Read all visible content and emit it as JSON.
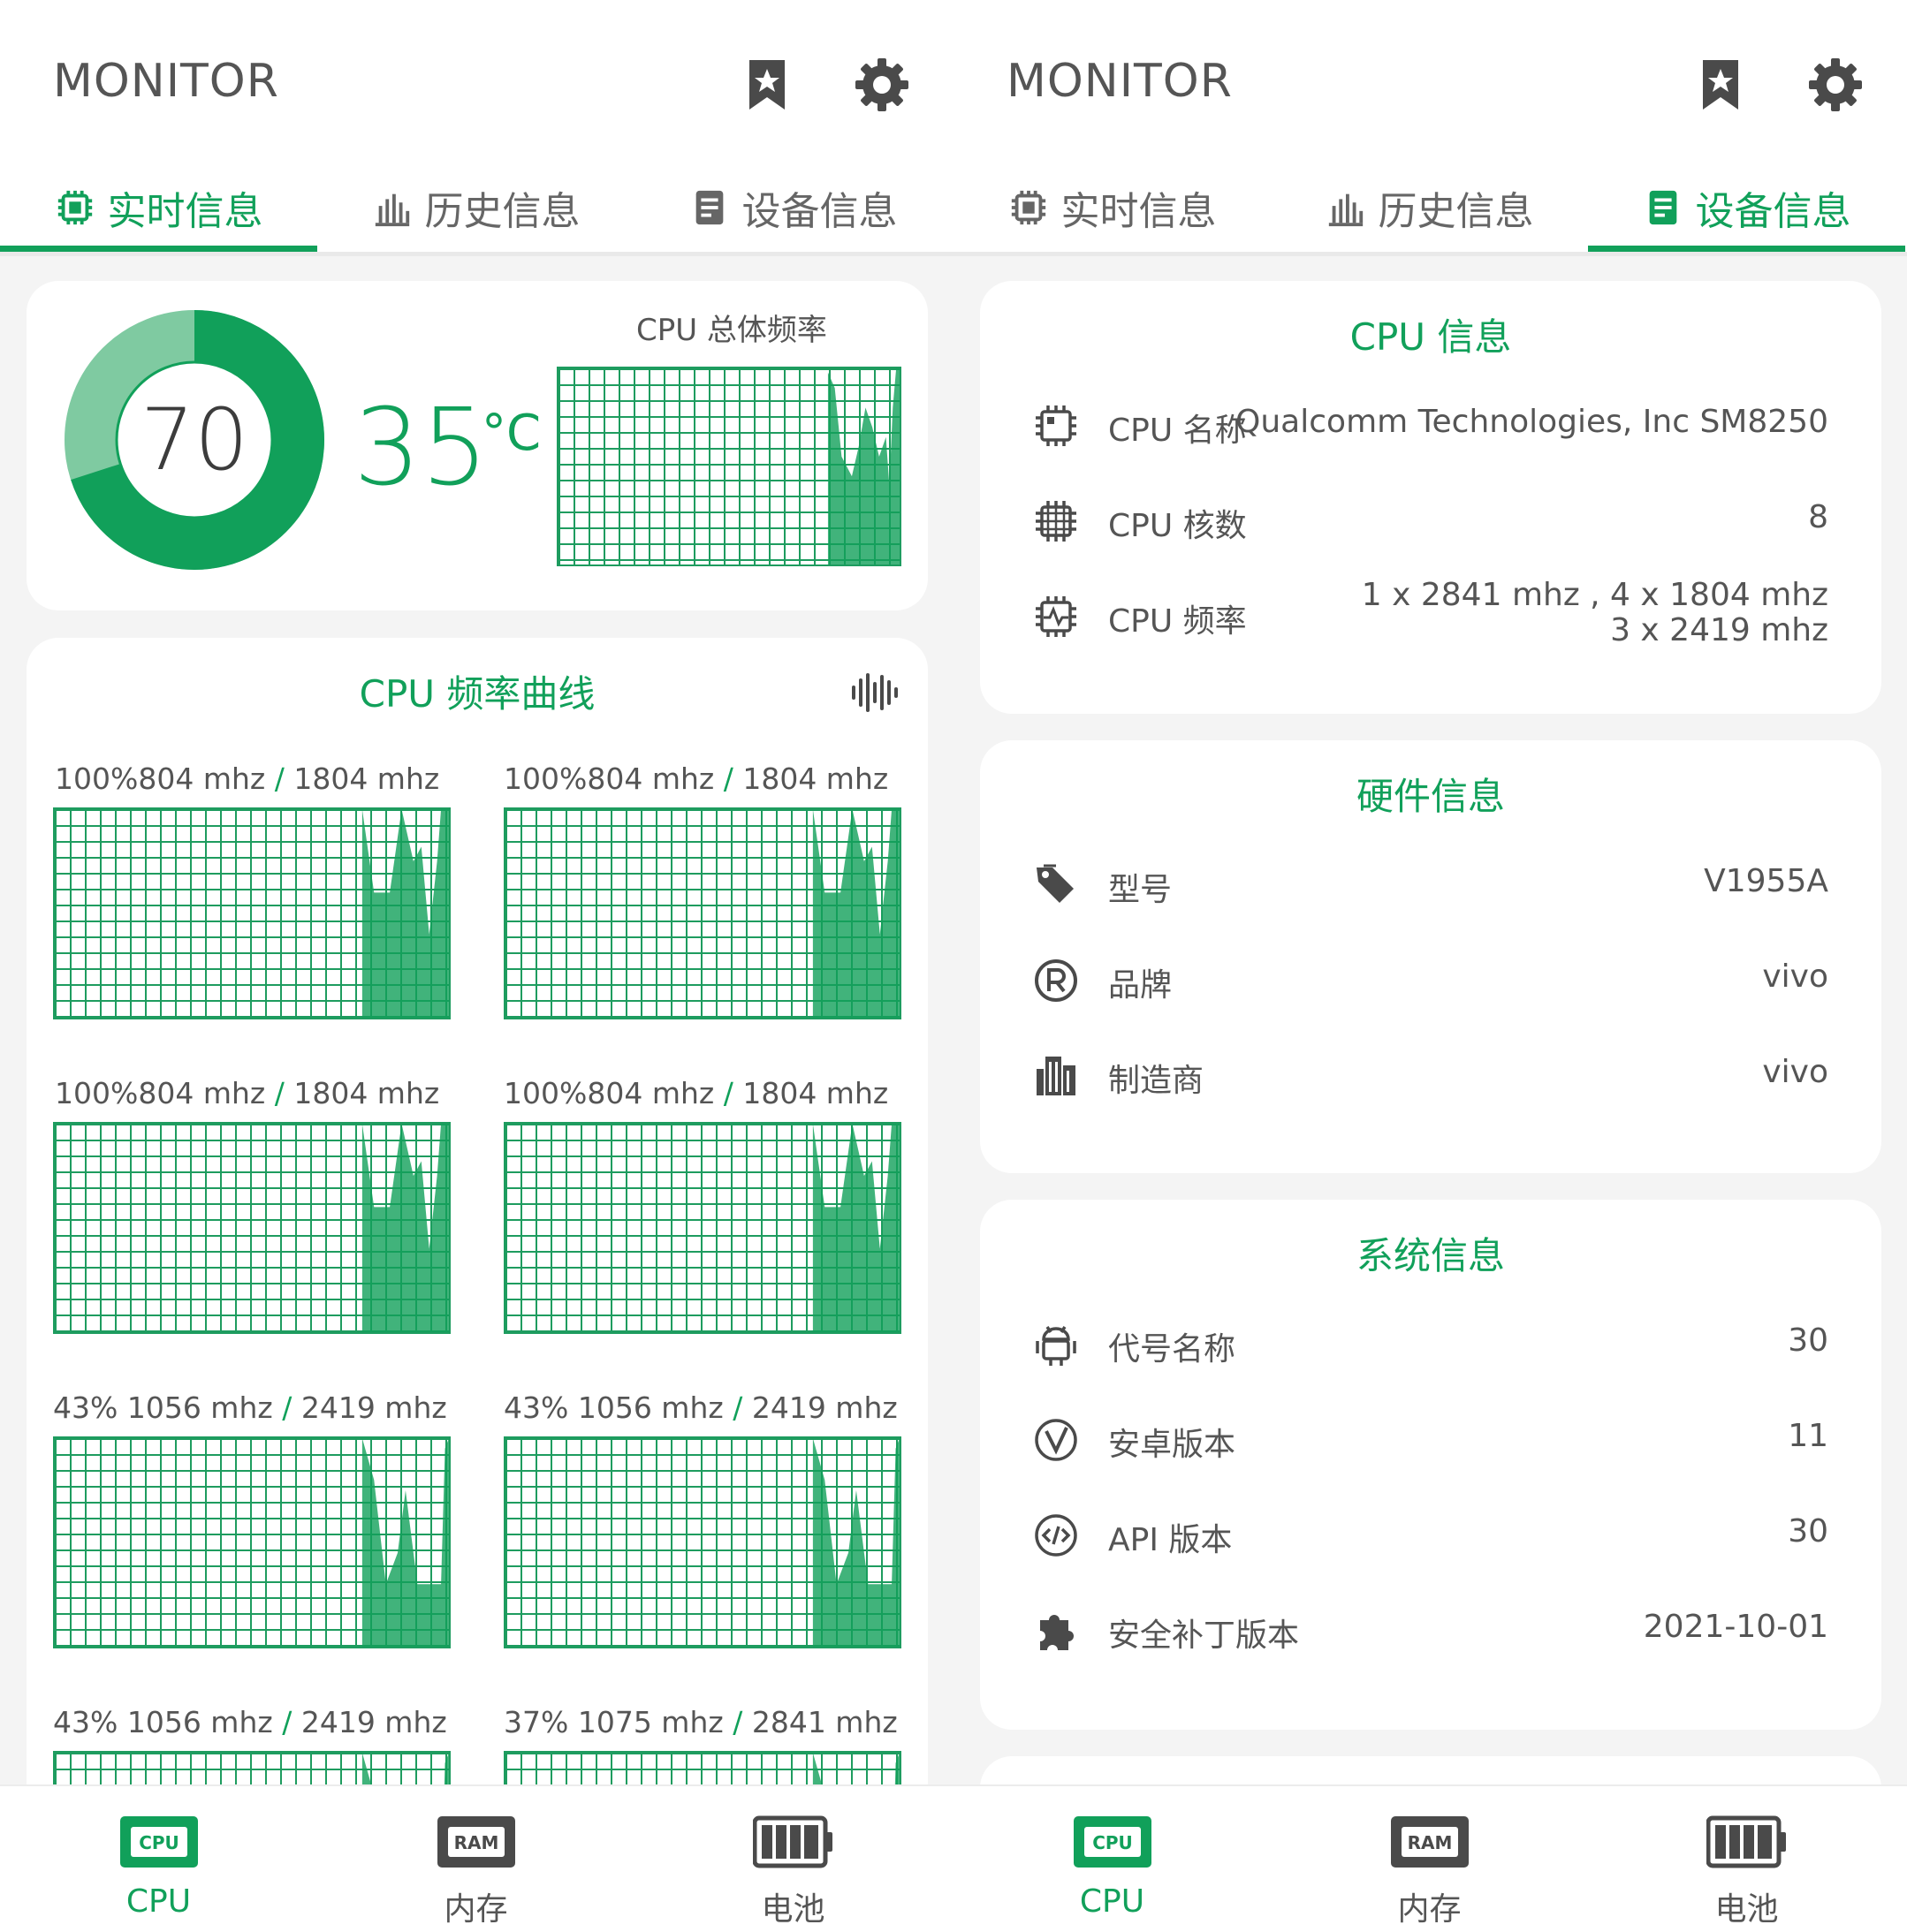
{
  "left": {
    "app_title": "MONITOR",
    "tabs": [
      {
        "label": "实时信息",
        "icon": "chip-icon"
      },
      {
        "label": "历史信息",
        "icon": "bar-chart-icon"
      },
      {
        "label": "设备信息",
        "icon": "document-icon"
      }
    ],
    "active_tab": 0,
    "gauge": {
      "value": "70",
      "percent": 70
    },
    "temperature": {
      "value": "35",
      "unit": "°C"
    },
    "total_freq_label": "CPU 总体频率",
    "freq_curve_title": "CPU 频率曲线",
    "cores": [
      {
        "label_a": "100%804 mhz",
        "label_b": "1804 mhz"
      },
      {
        "label_a": "100%804 mhz",
        "label_b": "1804 mhz"
      },
      {
        "label_a": "100%804 mhz",
        "label_b": "1804 mhz"
      },
      {
        "label_a": "100%804 mhz",
        "label_b": "1804 mhz"
      },
      {
        "label_a": "43% 1056 mhz",
        "label_b": "2419 mhz"
      },
      {
        "label_a": "43% 1056 mhz",
        "label_b": "2419 mhz"
      },
      {
        "label_a": "43% 1056 mhz",
        "label_b": "2419 mhz"
      },
      {
        "label_a": "37% 1075 mhz",
        "label_b": "2841 mhz"
      }
    ],
    "slash": "/"
  },
  "right": {
    "app_title": "MONITOR",
    "tabs": [
      {
        "label": "实时信息",
        "icon": "chip-icon"
      },
      {
        "label": "历史信息",
        "icon": "bar-chart-icon"
      },
      {
        "label": "设备信息",
        "icon": "document-icon"
      }
    ],
    "active_tab": 2,
    "cpu_info": {
      "title": "CPU 信息",
      "rows": [
        {
          "icon": "chip-icon",
          "label": "CPU 名称",
          "value": "Qualcomm Technologies, Inc SM8250"
        },
        {
          "icon": "chip-grid-icon",
          "label": "CPU 核数",
          "value": "8"
        },
        {
          "icon": "chip-pulse-icon",
          "label": "CPU 频率",
          "value": "1 x 2841 mhz , 4 x 1804 mhz",
          "value2": "3 x 2419 mhz"
        }
      ]
    },
    "hardware_info": {
      "title": "硬件信息",
      "rows": [
        {
          "icon": "tag-icon",
          "label": "型号",
          "value": "V1955A"
        },
        {
          "icon": "registered-icon",
          "label": "品牌",
          "value": "vivo"
        },
        {
          "icon": "building-icon",
          "label": "制造商",
          "value": "vivo"
        }
      ]
    },
    "system_info": {
      "title": "系统信息",
      "rows": [
        {
          "icon": "android-icon",
          "label": "代号名称",
          "value": "30"
        },
        {
          "icon": "v-circle-icon",
          "label": "安卓版本",
          "value": "11"
        },
        {
          "icon": "code-icon",
          "label": "API 版本",
          "value": "30"
        },
        {
          "icon": "puzzle-icon",
          "label": "安全补丁版本",
          "value": "2021-10-01"
        }
      ]
    }
  },
  "bottom_nav": [
    {
      "label": "CPU",
      "icon": "cpu-icon",
      "icon_text": "CPU"
    },
    {
      "label": "内存",
      "icon": "ram-icon",
      "icon_text": "RAM"
    },
    {
      "label": "电池",
      "icon": "battery-icon"
    }
  ],
  "colors": {
    "accent": "#11a05a",
    "accent_light": "#7fcaa1",
    "text": "#555555",
    "card": "#ffffff",
    "background": "#f4f4f4"
  }
}
